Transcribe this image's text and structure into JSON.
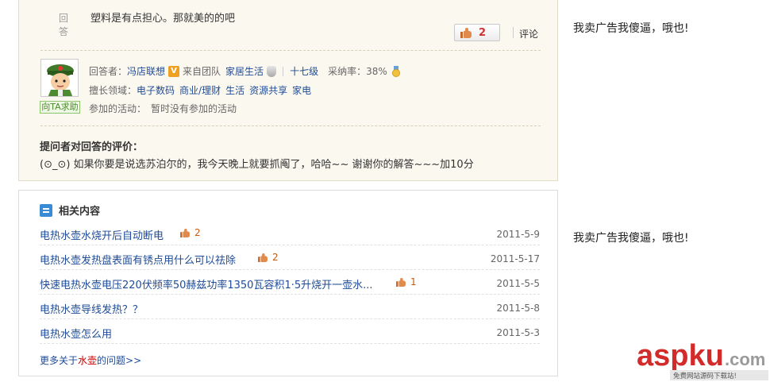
{
  "answer": {
    "label": "回答",
    "text": "塑料是有点担心。那就美的的吧",
    "like_count": "2",
    "comment_label": "评论"
  },
  "answerer": {
    "answerer_label": "回答者：",
    "name": "冯店联想",
    "from_team": "来自团队",
    "team": "家居生活",
    "level": "十七级",
    "adoption_label": "采纳率：",
    "adoption_rate": "38%",
    "expertise_label": "擅长领域：",
    "expertise": [
      "电子数码",
      "商业/理财",
      "生活",
      "资源共享",
      "家电"
    ],
    "activity_label": "参加的活动：",
    "activity": "暂时没有参加的活动",
    "help_button": "向TA求助"
  },
  "evaluation": {
    "title": "提问者对回答的评价：",
    "text": "(⊙_⊙) 如果你要是说选苏泊尔的，我今天晚上就要抓阄了，哈哈~~ 谢谢你的解答~~~加10分"
  },
  "related": {
    "title": "相关内容",
    "items": [
      {
        "title": "电热水壶水烧开后自动断电",
        "likes": "2",
        "date": "2011-5-9"
      },
      {
        "title": "电热水壶发热盘表面有锈点用什么可以祛除",
        "likes": "2",
        "date": "2011-5-17"
      },
      {
        "title": "快速电热水壶电压220伏频率50赫兹功率1350瓦容积1·5升烧开一壶水...",
        "likes": "1",
        "date": "2011-5-5"
      },
      {
        "title": "电热水壶导线发热？？",
        "likes": "",
        "date": "2011-5-8"
      },
      {
        "title": "电热水壶怎么用",
        "likes": "",
        "date": "2011-5-3"
      }
    ],
    "more_prefix": "更多关于",
    "more_keyword": "水壶",
    "more_suffix": "的问题>>"
  },
  "ads": {
    "ad1": "我卖广告我傻逼，哦也!",
    "ad2": "我卖广告我傻逼，哦也!"
  },
  "watermark": {
    "brand": "aspku",
    "domain": ".com",
    "tagline": "免费网站源码下载站!"
  },
  "colors": {
    "link_blue": "#1f4b96",
    "like_red": "#c33",
    "panel_bg": "#fbf8ef",
    "watermark_red": "#d32a2a"
  }
}
